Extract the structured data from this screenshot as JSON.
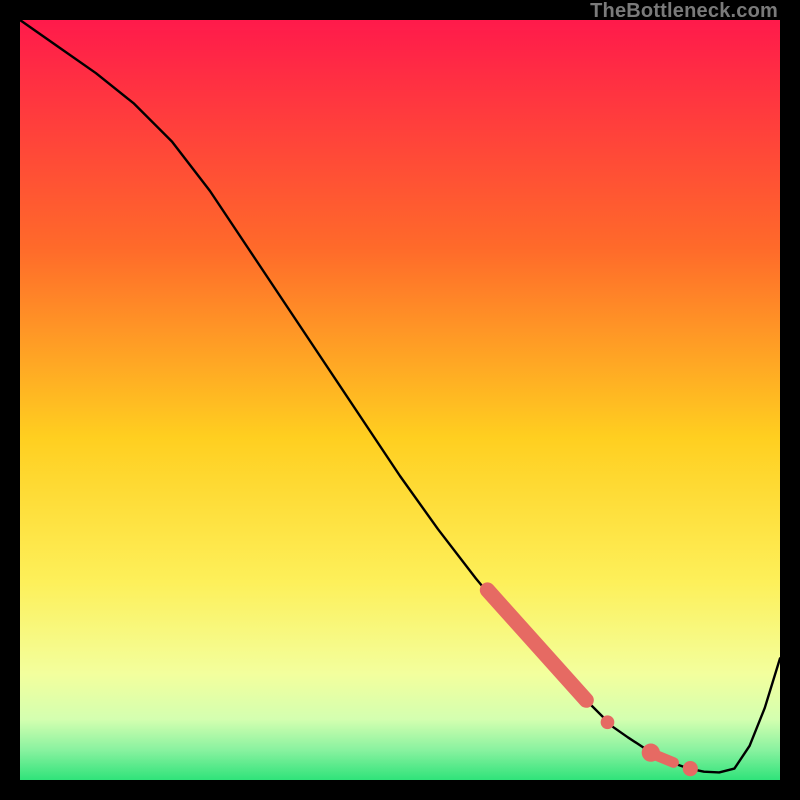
{
  "watermark": "TheBottleneck.com",
  "colors": {
    "top": "#ff1a4b",
    "upper_mid": "#ff8a1f",
    "mid": "#ffd21f",
    "lower_mid": "#f8f35a",
    "pale": "#f5ffb8",
    "green_light": "#9df7a7",
    "green": "#2fe37a",
    "curve": "#000000",
    "marker": "#e66a63",
    "frame": "#000000"
  },
  "chart_data": {
    "type": "line",
    "title": "",
    "xlabel": "",
    "ylabel": "",
    "xlim": [
      0,
      100
    ],
    "ylim": [
      0,
      100
    ],
    "x": [
      0,
      5,
      10,
      15,
      20,
      25,
      30,
      35,
      40,
      45,
      50,
      55,
      60,
      65,
      70,
      75,
      78,
      80,
      82,
      84,
      86,
      88,
      90,
      92,
      94,
      96,
      98,
      100
    ],
    "y": [
      100,
      96.5,
      93,
      89,
      84,
      77.5,
      70,
      62.5,
      55,
      47.5,
      40,
      33,
      26.5,
      20.5,
      15,
      10,
      7,
      5.6,
      4.3,
      3.1,
      2.2,
      1.5,
      1.1,
      1.0,
      1.5,
      4.5,
      9.5,
      16
    ],
    "markers": [
      {
        "shape": "segment",
        "x0": 61.5,
        "y0": 25.0,
        "x1": 74.5,
        "y1": 10.5,
        "thickness": 2.0
      },
      {
        "shape": "dot",
        "x": 77.3,
        "y": 7.6,
        "r": 0.9
      },
      {
        "shape": "dot",
        "x": 83.0,
        "y": 3.6,
        "r": 1.2
      },
      {
        "shape": "segment",
        "x0": 83.8,
        "y0": 3.2,
        "x1": 86.0,
        "y1": 2.3,
        "thickness": 1.4
      },
      {
        "shape": "dot",
        "x": 88.2,
        "y": 1.5,
        "r": 1.0
      }
    ]
  }
}
